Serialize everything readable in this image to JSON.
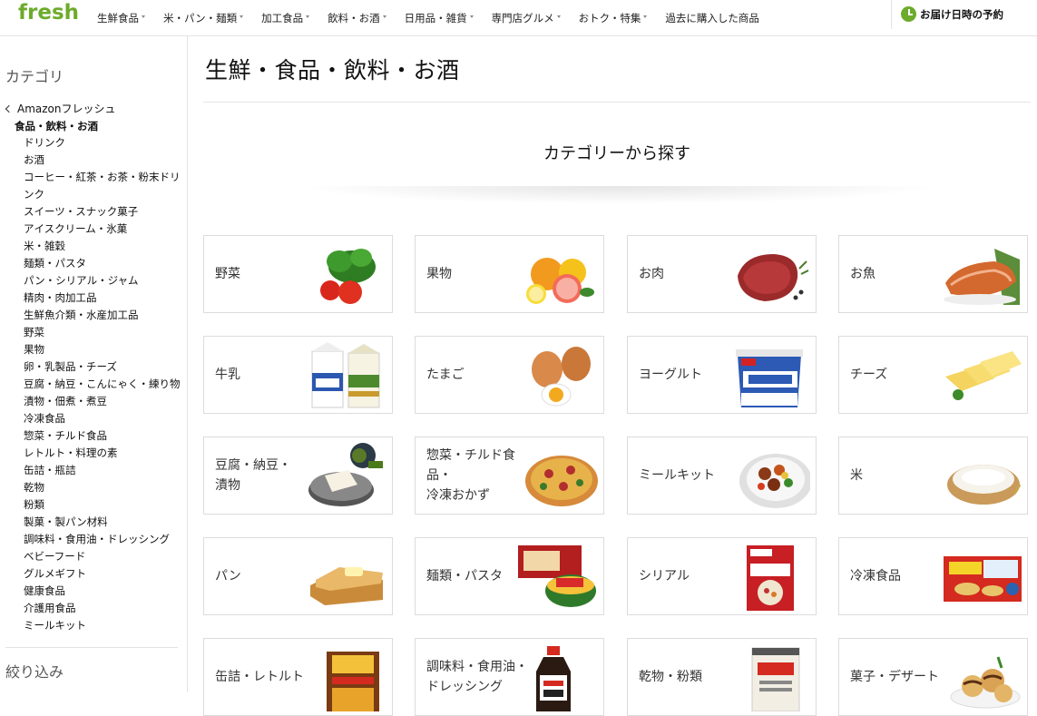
{
  "header": {
    "logo": "fresh",
    "nav": [
      {
        "label": "生鮮食品",
        "dropdown": true
      },
      {
        "label": "米・パン・麺類",
        "dropdown": true
      },
      {
        "label": "加工食品",
        "dropdown": true
      },
      {
        "label": "飲料・お酒",
        "dropdown": true
      },
      {
        "label": "日用品・雑貨",
        "dropdown": true
      },
      {
        "label": "専門店グルメ",
        "dropdown": true
      },
      {
        "label": "おトク・特集",
        "dropdown": true
      },
      {
        "label": "過去に購入した商品",
        "dropdown": false
      }
    ],
    "delivery_label": "お届け日時の予約",
    "accent_color": "#6cab2c"
  },
  "sidebar": {
    "heading": "カテゴリ",
    "back_label": "Amazonフレッシュ",
    "current": "食品・飲料・お酒",
    "items": [
      "ドリンク",
      "お酒",
      "コーヒー・紅茶・お茶・粉末ドリンク",
      "スイーツ・スナック菓子",
      "アイスクリーム・氷菓",
      "米・雑穀",
      "麺類・パスタ",
      "パン・シリアル・ジャム",
      "精肉・肉加工品",
      "生鮮魚介類・水産加工品",
      "野菜",
      "果物",
      "卵・乳製品・チーズ",
      "豆腐・納豆・こんにゃく・練り物",
      "漬物・佃煮・煮豆",
      "冷凍食品",
      "惣菜・チルド食品",
      "レトルト・料理の素",
      "缶詰・瓶詰",
      "乾物",
      "粉類",
      "製菓・製パン材料",
      "調味料・食用油・ドレッシング",
      "ベビーフード",
      "グルメギフト",
      "健康食品",
      "介護用食品",
      "ミールキット"
    ],
    "refine_heading": "絞り込み"
  },
  "main": {
    "title": "生鮮・食品・飲料・お酒",
    "section_heading": "カテゴリーから探す",
    "categories": [
      {
        "label": "野菜",
        "icon": "vegetables-image"
      },
      {
        "label": "果物",
        "icon": "fruit-image"
      },
      {
        "label": "お肉",
        "icon": "meat-image"
      },
      {
        "label": "お魚",
        "icon": "fish-image"
      },
      {
        "label": "牛乳",
        "icon": "milk-image"
      },
      {
        "label": "たまご",
        "icon": "eggs-image"
      },
      {
        "label": "ヨーグルト",
        "icon": "yogurt-image"
      },
      {
        "label": "チーズ",
        "icon": "cheese-image"
      },
      {
        "label": "豆腐・納豆・\n漬物",
        "icon": "tofu-image"
      },
      {
        "label": "惣菜・チルド食品・\n冷凍おかず",
        "icon": "pizza-image"
      },
      {
        "label": "ミールキット",
        "icon": "meal-kit-image"
      },
      {
        "label": "米",
        "icon": "rice-image"
      },
      {
        "label": "パン",
        "icon": "bread-image"
      },
      {
        "label": "麺類・パスタ",
        "icon": "noodles-image"
      },
      {
        "label": "シリアル",
        "icon": "cereal-image"
      },
      {
        "label": "冷凍食品",
        "icon": "frozen-gyoza-image"
      },
      {
        "label": "缶詰・レトルト",
        "icon": "retort-curry-image"
      },
      {
        "label": "調味料・食用油・\nドレッシング",
        "icon": "soy-sauce-image"
      },
      {
        "label": "乾物・粉類",
        "icon": "flour-bag-image"
      },
      {
        "label": "菓子・デザート",
        "icon": "dessert-image"
      }
    ]
  }
}
